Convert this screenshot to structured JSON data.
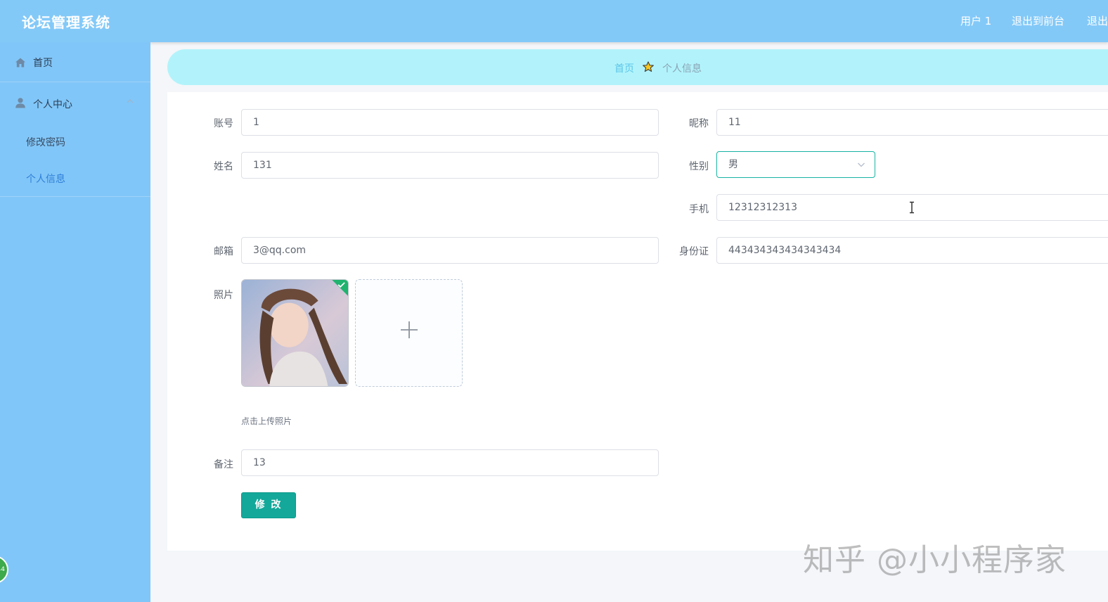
{
  "app": {
    "title": "论坛管理系统"
  },
  "topbar": {
    "user_label": "用户 1",
    "front_label": "退出到前台",
    "exit_label": "退出"
  },
  "sidebar": {
    "home_label": "首页",
    "personal_center_label": "个人中心",
    "submenu": [
      {
        "label": "修改密码"
      },
      {
        "label": "个人信息"
      }
    ],
    "active_item": "个人信息"
  },
  "breadcrumb": {
    "home": "首页",
    "current": "个人信息"
  },
  "form": {
    "account": {
      "label": "账号",
      "value": "1"
    },
    "nickname": {
      "label": "昵称",
      "value": "11"
    },
    "name": {
      "label": "姓名",
      "value": "131"
    },
    "gender": {
      "label": "性别",
      "value": "男"
    },
    "phone": {
      "label": "手机",
      "value": "12312312313"
    },
    "email": {
      "label": "邮箱",
      "value": "3@qq.com"
    },
    "idcard": {
      "label": "身份证",
      "value": "443434343434343434"
    },
    "photo": {
      "label": "照片",
      "hint": "点击上传照片"
    },
    "remark": {
      "label": "备注",
      "value": "13"
    },
    "submit_label": "修 改"
  },
  "watermark": "知乎 @小小程序家",
  "colors": {
    "topbar": "#83c9f8",
    "sidebar": "#81c6f8",
    "breadcrumb": "#b2f3fb",
    "accent": "#13a89a"
  },
  "icons": [
    "home-icon",
    "user-icon",
    "chevron-up-icon",
    "star-icon",
    "chevron-down-icon",
    "plus-icon",
    "check-icon",
    "text-cursor-icon"
  ]
}
